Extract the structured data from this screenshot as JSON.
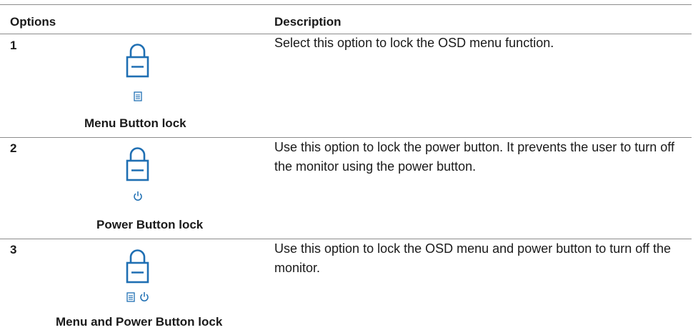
{
  "header": {
    "options_label": "Options",
    "description_label": "Description"
  },
  "rows": [
    {
      "number": "1",
      "caption": "Menu Button lock",
      "description": "Select this option to lock the OSD menu function.",
      "icons": [
        "lock-icon",
        "menu-icon"
      ]
    },
    {
      "number": "2",
      "caption": "Power Button lock",
      "description": "Use this option to lock the power button. It prevents the user to turn off the monitor using the power button.",
      "icons": [
        "lock-icon",
        "power-icon"
      ]
    },
    {
      "number": "3",
      "caption": "Menu and Power Button lock",
      "description": "Use this option to lock the OSD menu and power button to turn off the monitor.",
      "icons": [
        "lock-icon",
        "menu-icon",
        "power-icon"
      ]
    }
  ],
  "colors": {
    "icon_accent": "#1f6fb3",
    "rule": "#8c8c8c",
    "text": "#1a1a1a"
  }
}
